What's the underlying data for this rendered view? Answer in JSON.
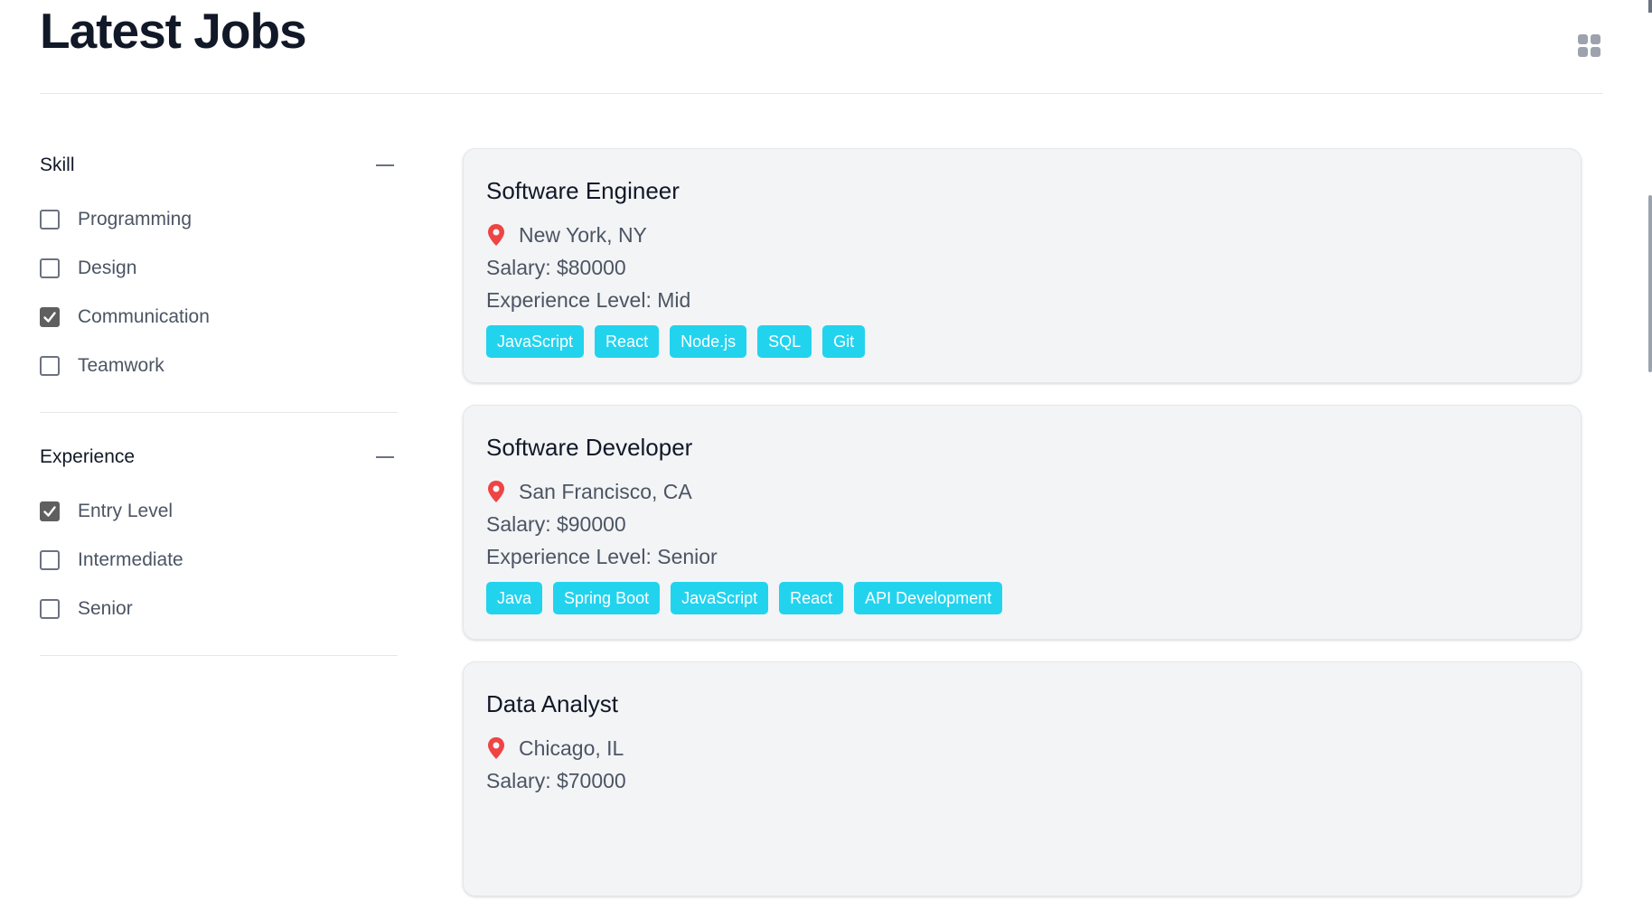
{
  "header": {
    "title": "Latest Jobs",
    "view_toggle_icon": "grid-icon"
  },
  "filters": [
    {
      "title": "Skill",
      "options": [
        {
          "label": "Programming",
          "checked": false
        },
        {
          "label": "Design",
          "checked": false
        },
        {
          "label": "Communication",
          "checked": true
        },
        {
          "label": "Teamwork",
          "checked": false
        }
      ]
    },
    {
      "title": "Experience",
      "options": [
        {
          "label": "Entry Level",
          "checked": true
        },
        {
          "label": "Intermediate",
          "checked": false
        },
        {
          "label": "Senior",
          "checked": false
        }
      ]
    }
  ],
  "jobs": [
    {
      "title": "Software Engineer",
      "location": "New York, NY",
      "salary": "Salary: $80000",
      "experience": "Experience Level: Mid",
      "tags": [
        "JavaScript",
        "React",
        "Node.js",
        "SQL",
        "Git"
      ]
    },
    {
      "title": "Software Developer",
      "location": "San Francisco, CA",
      "salary": "Salary: $90000",
      "experience": "Experience Level: Senior",
      "tags": [
        "Java",
        "Spring Boot",
        "JavaScript",
        "React",
        "API Development"
      ]
    },
    {
      "title": "Data Analyst",
      "location": "Chicago, IL",
      "salary": "Salary: $70000",
      "experience": "",
      "tags": []
    }
  ],
  "colors": {
    "tag_background": "#22d3ee",
    "pin": "#ef4444",
    "checkbox_checked": "#5f5f5f"
  }
}
